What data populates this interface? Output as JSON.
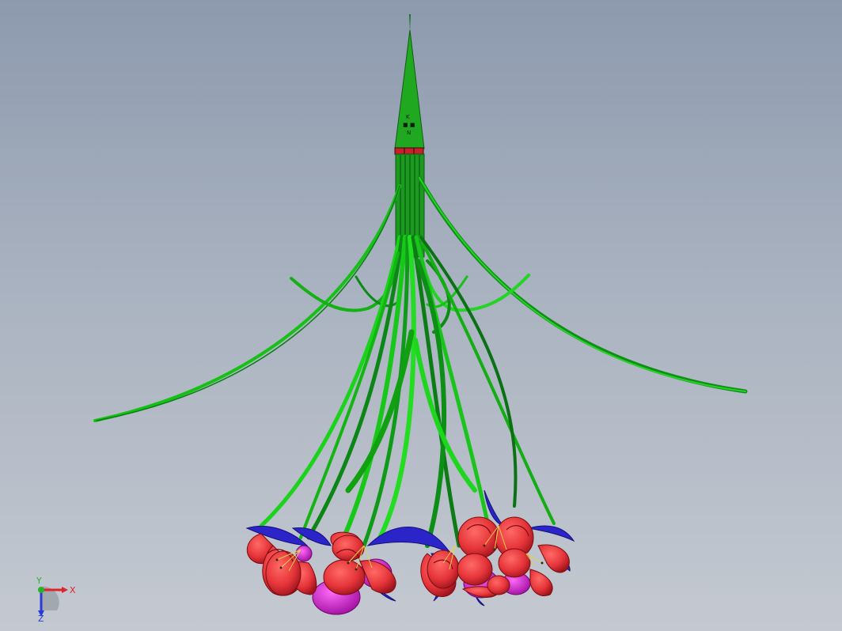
{
  "viewport": {
    "background_top": "#8d9aae",
    "background_bottom": "#c4c9d1"
  },
  "model": {
    "description_icon": "hanging-lily-chandelier-model",
    "stem_color": "#1ea51e",
    "leaf_dark": "#0b7a17",
    "leaf_light": "#18e018",
    "petal_color": "#e8353a",
    "petal_inner": "#b81c25",
    "sepal_color": "#2a22c8",
    "bud_color": "#d416d0",
    "stamen_color": "#e7d54a"
  },
  "triad": {
    "x_label": "X",
    "y_label": "Y",
    "z_label": "Z",
    "x_color": "#e0222a",
    "y_color": "#27b22b",
    "z_color": "#2a3ad8"
  }
}
